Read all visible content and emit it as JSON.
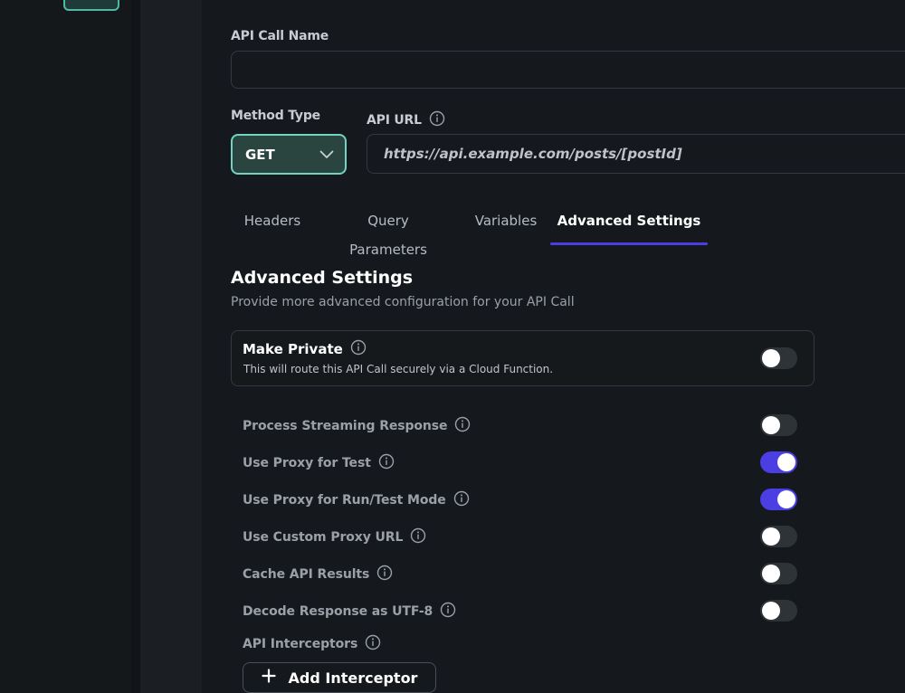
{
  "form": {
    "name_label": "API Call Name",
    "name_value": "",
    "method_label": "Method Type",
    "method_value": "GET",
    "url_label": "API URL",
    "url_value": "https://api.example.com/posts/[postId]"
  },
  "tabs": [
    {
      "label": "Headers",
      "active": false
    },
    {
      "label": "Query Parameters",
      "active": false
    },
    {
      "label": "Variables",
      "active": false
    },
    {
      "label": "Advanced Settings",
      "active": true
    }
  ],
  "advanced": {
    "title": "Advanced Settings",
    "subtitle": "Provide more advanced configuration for your API Call",
    "private": {
      "title": "Make Private",
      "description": "This will route this API Call securely via a Cloud Function.",
      "enabled": false
    },
    "settings": [
      {
        "label": "Process Streaming Response",
        "enabled": false
      },
      {
        "label": "Use Proxy for Test",
        "enabled": true
      },
      {
        "label": "Use Proxy for Run/Test Mode",
        "enabled": true
      },
      {
        "label": "Use Custom Proxy URL",
        "enabled": false
      },
      {
        "label": "Cache API Results",
        "enabled": false
      },
      {
        "label": "Decode Response as UTF-8",
        "enabled": false
      }
    ],
    "interceptors_label": "API Interceptors",
    "add_interceptor_label": "Add Interceptor"
  },
  "colors": {
    "accent": "#4b3fe4",
    "method_border": "#6fd4c1",
    "method_bg": "#2a4540",
    "background": "#15191d"
  },
  "icons": {
    "info": "info-icon",
    "dropdown": "chevron-down-icon",
    "add": "plus-icon"
  }
}
